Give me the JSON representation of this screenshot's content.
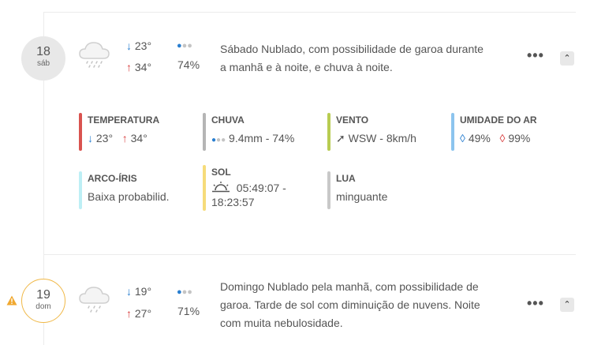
{
  "days": [
    {
      "day": "18",
      "weekday": "sáb",
      "icon": "cloud-drizzle-icon",
      "low": "23°",
      "high": "34°",
      "rain_chance": "74%",
      "summary_line1": "Sábado Nublado, com possibilidade de garoa durante",
      "summary_line2": "a manhã e à noite, e chuva à noite.",
      "details": {
        "temperature": {
          "label": "TEMPERATURA",
          "low": "23°",
          "high": "34°",
          "color": "#d9534f"
        },
        "rain": {
          "label": "CHUVA",
          "value": "9.4mm - 74%",
          "color": "#b5b5b5"
        },
        "wind": {
          "label": "VENTO",
          "value": "WSW - 8km/h",
          "color": "#b8cc52"
        },
        "humidity": {
          "label": "UMIDADE DO AR",
          "min": "49%",
          "max": "99%",
          "color": "#8cc4ee"
        },
        "rainbow": {
          "label": "ARCO-ÍRIS",
          "value": "Baixa probabilid.",
          "color": "#bdeff5"
        },
        "sun": {
          "label": "SOL",
          "value_line1": "05:49:07 -",
          "value_line2": "18:23:57",
          "color": "#f6dc7a"
        },
        "moon": {
          "label": "LUA",
          "value": "minguante",
          "color": "#c8c8c8"
        }
      }
    },
    {
      "day": "19",
      "weekday": "dom",
      "icon": "cloud-drizzle-icon",
      "low": "19°",
      "high": "27°",
      "rain_chance": "71%",
      "warning": true,
      "summary_line1": "Domingo Nublado pela manhã, com possibilidade de",
      "summary_line2": "garoa. Tarde de sol com diminuição de nuvens. Noite",
      "summary_line3": "com muita nebulosidade."
    }
  ],
  "ui": {
    "more_label": "•••",
    "collapse_label": "⌃"
  }
}
